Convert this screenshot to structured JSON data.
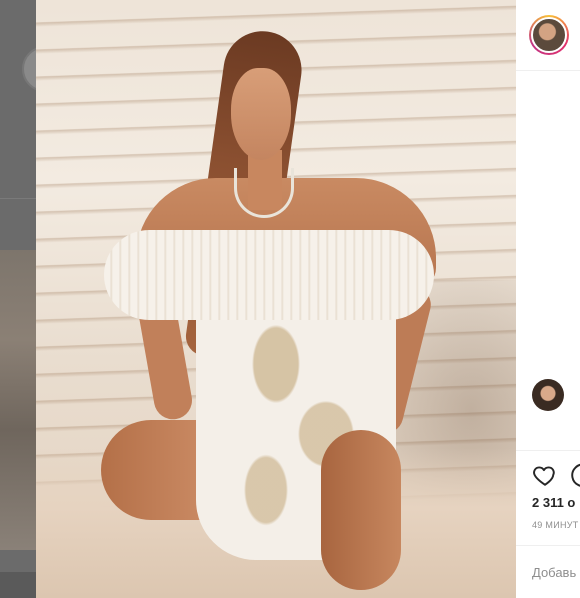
{
  "post": {
    "likes_text": "2 311 о",
    "time_text": "49 минут",
    "add_comment_placeholder": "Добавь",
    "author_avatar": "author-avatar",
    "comment_avatar": "commenter-avatar"
  },
  "icons": {
    "like": "heart-icon",
    "comment": "comment-bubble-icon"
  },
  "colors": {
    "overlay_bg": "#5f5f5f",
    "panel_bg": "#ffffff",
    "text_primary": "#262626",
    "text_secondary": "#8e8e8e",
    "divider": "#efefef"
  }
}
